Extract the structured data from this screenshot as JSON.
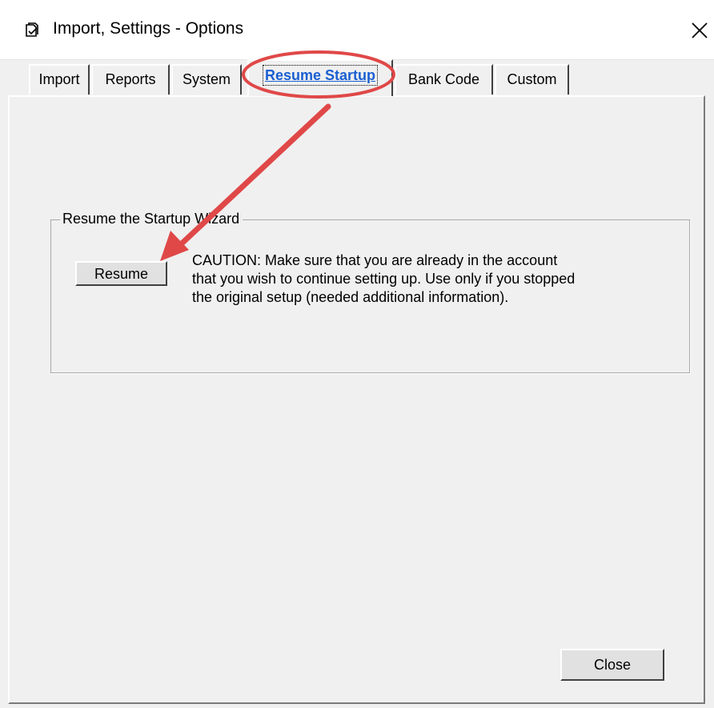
{
  "window": {
    "title": "Import, Settings - Options",
    "icon": "window-app-icon",
    "close_icon": "close-icon"
  },
  "tabs": [
    {
      "label": "Import",
      "active": false
    },
    {
      "label": "Reports",
      "active": false
    },
    {
      "label": "System",
      "active": false
    },
    {
      "label": "Resume Startup",
      "active": true
    },
    {
      "label": "Bank Code",
      "active": false
    },
    {
      "label": "Custom",
      "active": false
    }
  ],
  "group": {
    "title": "Resume the Startup Wizard",
    "resume_button": "Resume",
    "caution_lines": [
      "CAUTION:  Make sure that you are already in the account",
      "that you wish to continue setting up.  Use only if you stopped",
      "the original setup (needed additional information)."
    ]
  },
  "footer": {
    "close_button": "Close"
  },
  "annotation": {
    "color": "#e04848",
    "shapes": [
      "ellipse-highlight",
      "arrow"
    ]
  }
}
